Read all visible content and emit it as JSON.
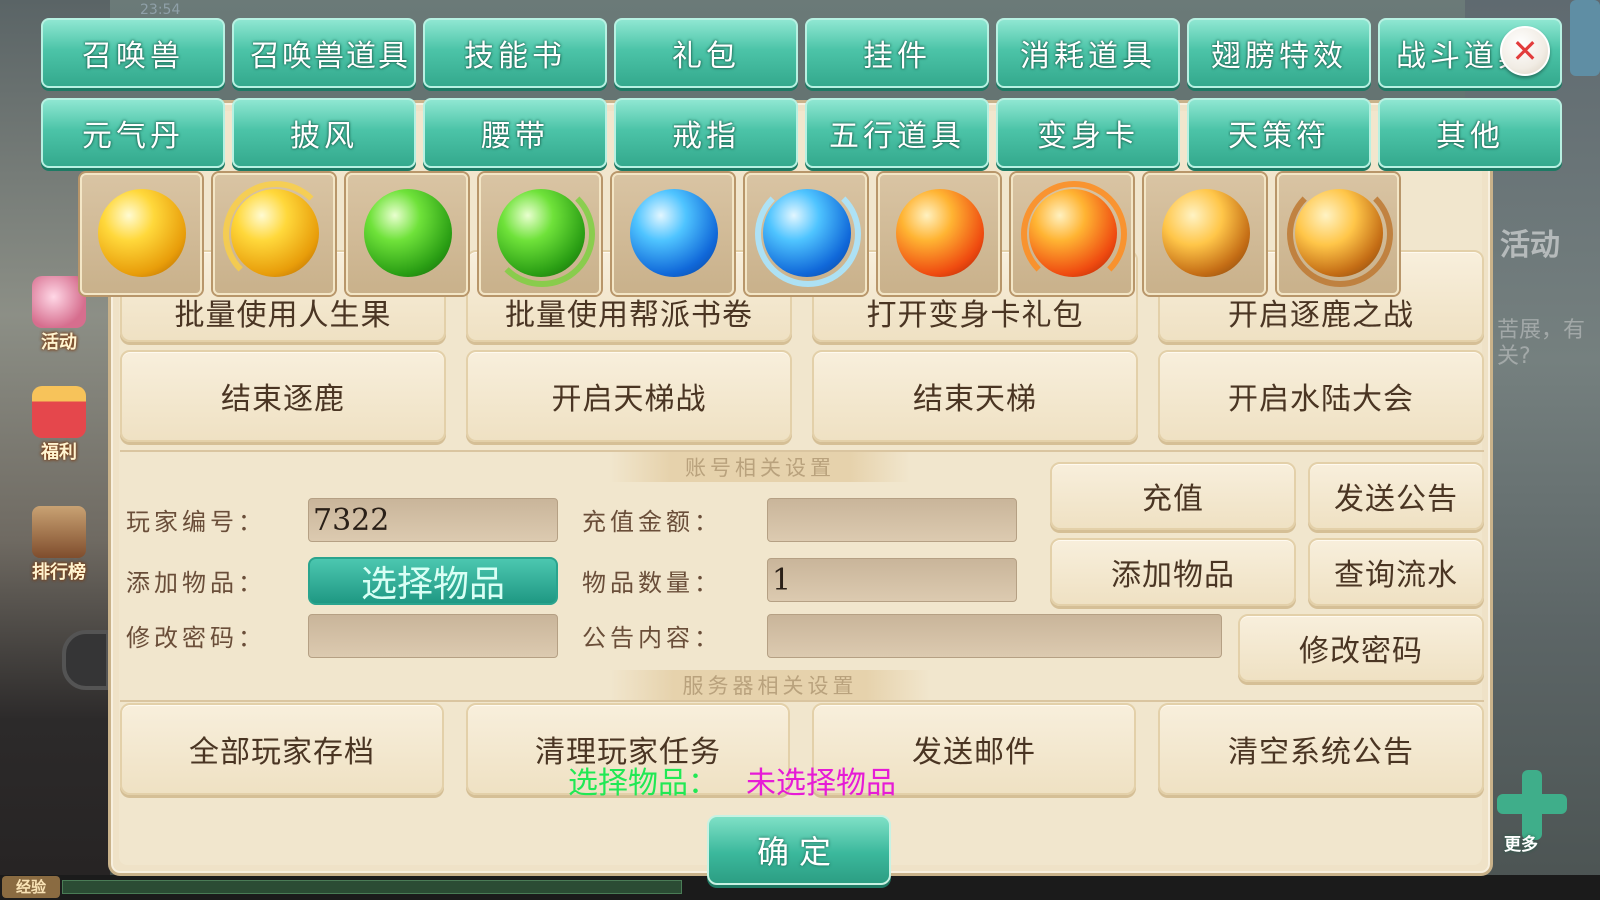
{
  "hud": {
    "time_text": "23:54",
    "left_buttons": [
      "活动",
      "福利",
      "排行榜"
    ],
    "exp_label": "经验",
    "right_activity": "活动",
    "right_hint": "苦展，有关?",
    "more_label": "更多"
  },
  "tabs_row1": [
    "召唤兽",
    "召唤兽道具",
    "技能书",
    "礼包",
    "挂件",
    "消耗道具",
    "翅膀特效",
    "战斗道具"
  ],
  "tabs_row2": [
    "元气丹",
    "披风",
    "腰带",
    "戒指",
    "五行道具",
    "变身卡",
    "天策符",
    "其他"
  ],
  "items": [
    {
      "icon": "gold-orb-icon"
    },
    {
      "icon": "gold-phoenix-orb-icon"
    },
    {
      "icon": "green-orb-icon"
    },
    {
      "icon": "green-vine-orb-icon"
    },
    {
      "icon": "blue-orb-icon"
    },
    {
      "icon": "blue-wave-orb-icon"
    },
    {
      "icon": "fire-orb-icon"
    },
    {
      "icon": "fire-flame-orb-icon"
    },
    {
      "icon": "earth-orb-icon"
    },
    {
      "icon": "earth-rock-orb-icon"
    }
  ],
  "gm": {
    "hidden_row1": [
      "批量使用人生果",
      "批量使用帮派书卷",
      "打开变身卡礼包",
      "开启逐鹿之战"
    ],
    "row2": [
      "结束逐鹿",
      "开启天梯战",
      "结束天梯",
      "开启水陆大会"
    ],
    "account_section": "账号相关设置",
    "server_section": "服务器相关设置",
    "labels": {
      "player_id": "玩家编号：",
      "add_item": "添加物品：",
      "change_pwd": "修改密码：",
      "recharge_amount": "充值金额：",
      "item_count": "物品数量：",
      "notice_content": "公告内容："
    },
    "values": {
      "player_id": "7322",
      "recharge_amount": "",
      "item_count": "1",
      "change_pwd": "",
      "notice_content": ""
    },
    "select_item_btn": "选择物品",
    "account_buttons": {
      "recharge": "充值",
      "send_notice": "发送公告",
      "add_item": "添加物品",
      "query_flow": "查询流水",
      "change_pwd": "修改密码"
    },
    "server_buttons": [
      "全部玩家存档",
      "清理玩家任务",
      "发送邮件",
      "清空系统公告"
    ],
    "status_key": "选择物品：",
    "status_value": "未选择物品",
    "confirm": "确定"
  },
  "colors": {
    "tab_teal": "#4cc4a8",
    "panel_bg": "#efe2c7",
    "status_green": "#21e854",
    "status_magenta": "#e61bd6",
    "close_red": "#e23c3c"
  }
}
